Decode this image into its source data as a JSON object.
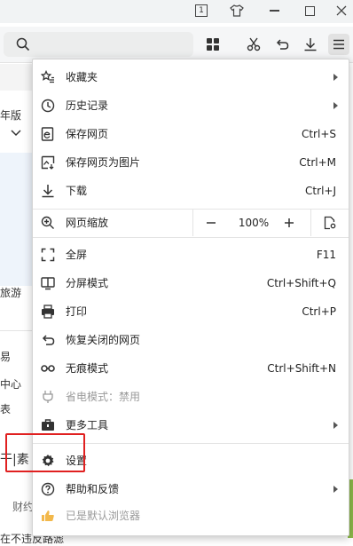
{
  "titlebar": {
    "icons": [
      "tab-count-icon",
      "skin-icon",
      "minimize-icon",
      "maximize-icon",
      "close-icon"
    ],
    "tab_count": "1"
  },
  "toolbar": {
    "icons": [
      "search-icon",
      "apps-icon",
      "scissors-icon",
      "undo-icon",
      "download-icon",
      "menu-icon"
    ]
  },
  "background": {
    "fragments": [
      "年版",
      "旅游",
      "易",
      "中心",
      "表",
      "干|素",
      "财约",
      "在不违反路滤"
    ]
  },
  "menu": {
    "items": [
      {
        "icon": "favorites-icon",
        "label": "收藏夹",
        "shortcut": ""
      },
      {
        "icon": "history-icon",
        "label": "历史记录",
        "shortcut": ""
      },
      {
        "icon": "save-page-icon",
        "label": "保存网页",
        "shortcut": "Ctrl+S"
      },
      {
        "icon": "save-image-icon",
        "label": "保存网页为图片",
        "shortcut": "Ctrl+M"
      },
      {
        "icon": "download-icon",
        "label": "下载",
        "shortcut": "Ctrl+J"
      },
      {
        "icon": "zoom-icon",
        "label": "网页缩放",
        "zoom_value": "100%"
      },
      {
        "icon": "fullscreen-icon",
        "label": "全屏",
        "shortcut": "F11"
      },
      {
        "icon": "split-screen-icon",
        "label": "分屏模式",
        "shortcut": "Ctrl+Shift+Q"
      },
      {
        "icon": "print-icon",
        "label": "打印",
        "shortcut": "Ctrl+P"
      },
      {
        "icon": "restore-icon",
        "label": "恢复关闭的网页",
        "shortcut": ""
      },
      {
        "icon": "incognito-icon",
        "label": "无痕模式",
        "shortcut": "Ctrl+Shift+N"
      },
      {
        "icon": "power-saver-icon",
        "label": "省电模式：禁用",
        "shortcut": ""
      },
      {
        "icon": "tools-icon",
        "label": "更多工具",
        "shortcut": ""
      },
      {
        "icon": "settings-icon",
        "label": "设置",
        "shortcut": ""
      },
      {
        "icon": "help-icon",
        "label": "帮助和反馈",
        "shortcut": ""
      },
      {
        "icon": "default-browser-icon",
        "label": "已是默认浏览器",
        "shortcut": ""
      }
    ]
  },
  "colors": {
    "highlight_border": "#e02020",
    "disabled_text": "#9a9a9a",
    "default_browser_icon": "#f2b84b"
  }
}
